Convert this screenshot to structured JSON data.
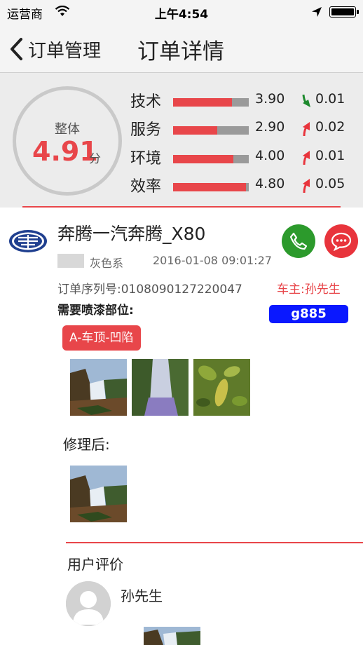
{
  "status_bar": {
    "carrier": "运营商",
    "time": "上午4:54",
    "icons": [
      "wifi-icon",
      "location-arrow-icon",
      "battery-icon"
    ]
  },
  "nav": {
    "back_label": "订单管理",
    "title": "订单详情",
    "back_icon": "chevron-left-icon"
  },
  "rating": {
    "overall_label": "整体",
    "overall_value": "4.91",
    "overall_unit": "分",
    "metrics": [
      {
        "label": "技术",
        "score": "3.90",
        "fill": 0.78,
        "trend": "down",
        "change": "0.01"
      },
      {
        "label": "服务",
        "score": "2.90",
        "fill": 0.58,
        "trend": "up",
        "change": "0.02"
      },
      {
        "label": "环境",
        "score": "4.00",
        "fill": 0.8,
        "trend": "up",
        "change": "0.01"
      },
      {
        "label": "效率",
        "score": "4.80",
        "fill": 0.96,
        "trend": "up",
        "change": "0.05"
      }
    ]
  },
  "order": {
    "brand_icon": "faw-logo-icon",
    "car_title": "奔腾一汽奔腾_X80",
    "color_name": "灰色系",
    "datetime": "2016-01-08 09:01:27",
    "serial": "订单序列号:0108090127220047",
    "owner": "车主:孙先生",
    "paint_parts_label": "需要喷漆部位:",
    "plate": "g885",
    "damage_tag": "A-车顶-凹陷",
    "photos_before": [
      "waterfall-photo",
      "waterfall-photo",
      "leaves-photo"
    ],
    "after_repair_label": "修理后:",
    "photos_after": [
      "waterfall-photo"
    ]
  },
  "review": {
    "section_label": "用户评价",
    "reviewer_name": "孙先生",
    "avatar_icon": "default-avatar-icon"
  },
  "colors": {
    "accent_red": "#e8464a",
    "call_green": "#2c9a2c",
    "plate_blue": "#0a18ff"
  }
}
